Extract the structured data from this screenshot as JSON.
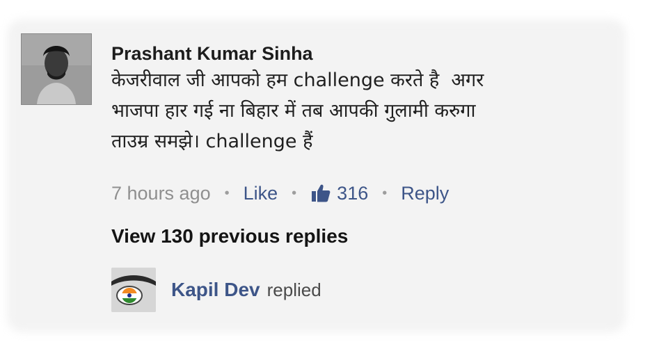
{
  "comment": {
    "author": "Prashant Kumar Sinha",
    "text": "केजरीवाल जी आपको हम challenge करते है  अगर\nभाजपा हार गई ना बिहार में तब आपकी गुलामी करुगा\nताउम्र समझे। challenge हैं",
    "time": "7 hours ago",
    "separator": "•",
    "like_label": "Like",
    "like_count": "316",
    "reply_label": "Reply",
    "like_icon": "thumbs-up-icon"
  },
  "view_previous": "View 130 previous replies",
  "reply_preview": {
    "name": "Kapil Dev",
    "suffix": "replied"
  },
  "colors": {
    "link": "#3d5588",
    "text": "#1f1f1f",
    "muted": "#8f8f8f"
  }
}
